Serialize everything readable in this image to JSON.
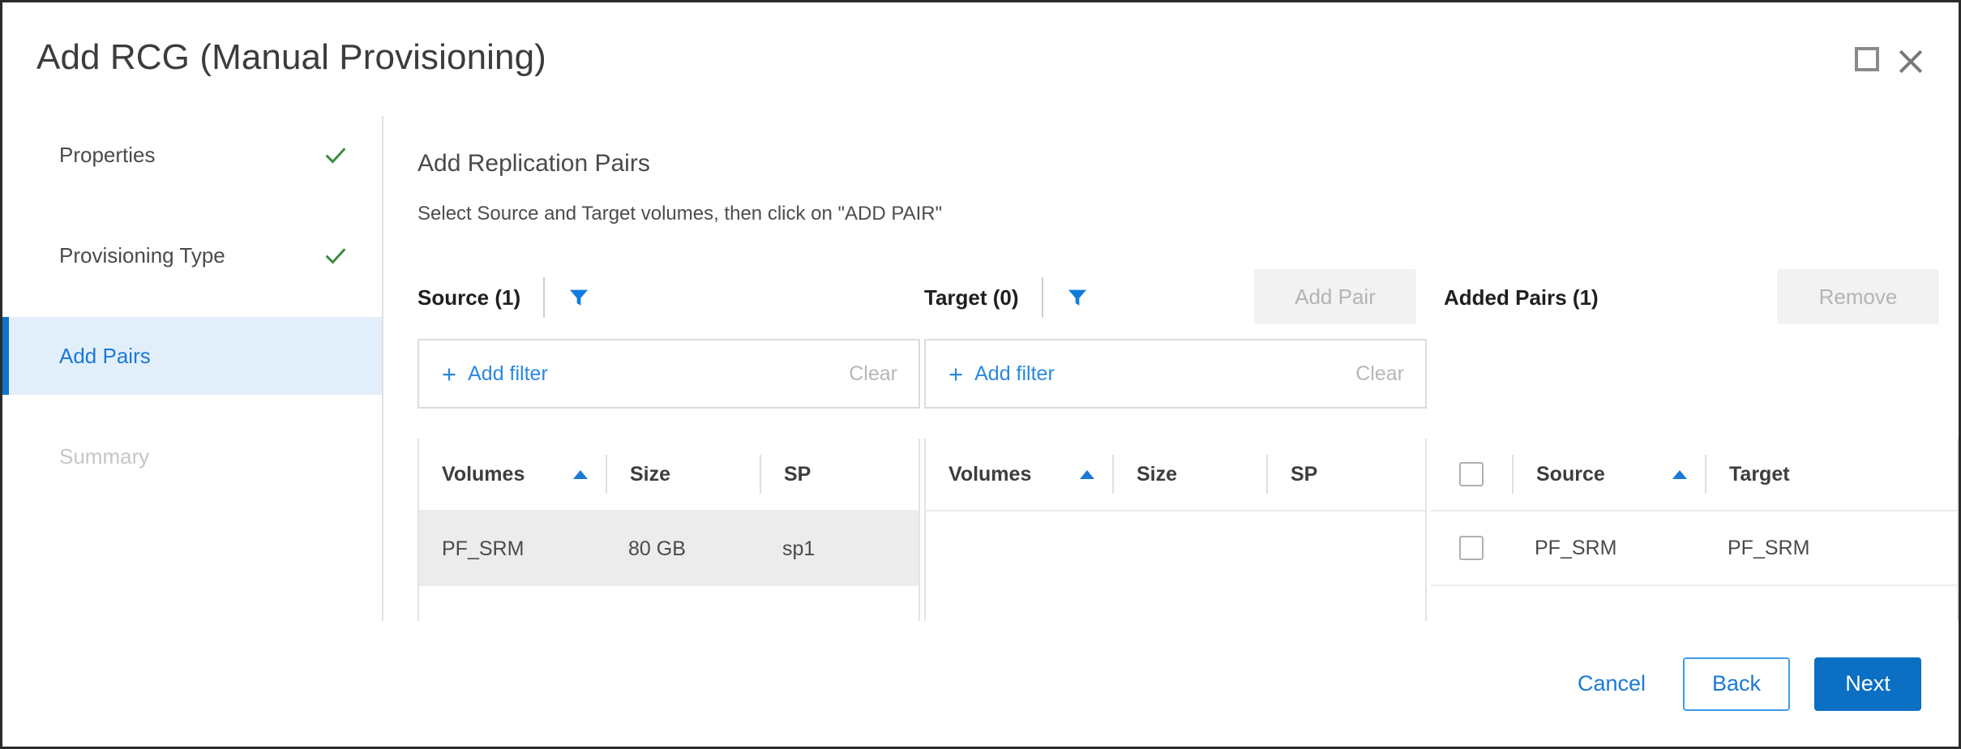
{
  "window": {
    "title": "Add RCG (Manual Provisioning)",
    "maximize_icon": "maximize-icon",
    "close_icon": "close-icon"
  },
  "sidebar": {
    "items": [
      {
        "label": "Properties",
        "state": "complete",
        "icon": "check-icon"
      },
      {
        "label": "Provisioning Type",
        "state": "complete",
        "icon": "check-icon"
      },
      {
        "label": "Add Pairs",
        "state": "active",
        "icon": ""
      },
      {
        "label": "Summary",
        "state": "disabled",
        "icon": ""
      }
    ]
  },
  "main": {
    "title": "Add Replication Pairs",
    "subtitle": "Select Source and Target volumes, then click on \"ADD PAIR\""
  },
  "source_panel": {
    "header_label": "Source (1)",
    "filter_icon": "filter-funnel-icon",
    "filter_bar": {
      "add_label": "Add filter",
      "clear_label": "Clear",
      "plus_icon": "plus-icon"
    },
    "columns": [
      "Volumes",
      "Size",
      "SP"
    ],
    "sort_column": "Volumes",
    "sort_direction": "asc",
    "rows": [
      {
        "volume": "PF_SRM",
        "size": "80 GB",
        "sp": "sp1",
        "selected": true
      }
    ]
  },
  "target_panel": {
    "header_label": "Target (0)",
    "filter_icon": "filter-funnel-icon",
    "filter_bar": {
      "add_label": "Add filter",
      "clear_label": "Clear",
      "plus_icon": "plus-icon"
    },
    "columns": [
      "Volumes",
      "Size",
      "SP"
    ],
    "sort_column": "Volumes",
    "sort_direction": "asc",
    "rows": []
  },
  "add_pair_button": {
    "label": "Add Pair",
    "disabled": true
  },
  "added_pairs_panel": {
    "header_label": "Added Pairs (1)",
    "remove_button": {
      "label": "Remove",
      "disabled": true
    },
    "columns": [
      "Source",
      "Target"
    ],
    "sort_column": "Source",
    "sort_direction": "asc",
    "rows": [
      {
        "source": "PF_SRM",
        "target": "PF_SRM",
        "checked": false
      }
    ]
  },
  "footer": {
    "cancel_label": "Cancel",
    "back_label": "Back",
    "next_label": "Next"
  },
  "colors": {
    "accent": "#1a7ad6",
    "primary_button": "#0b6fc4",
    "active_step_bg": "#e2effb",
    "check_green": "#3a8c3a",
    "selected_row": "#ececec"
  }
}
